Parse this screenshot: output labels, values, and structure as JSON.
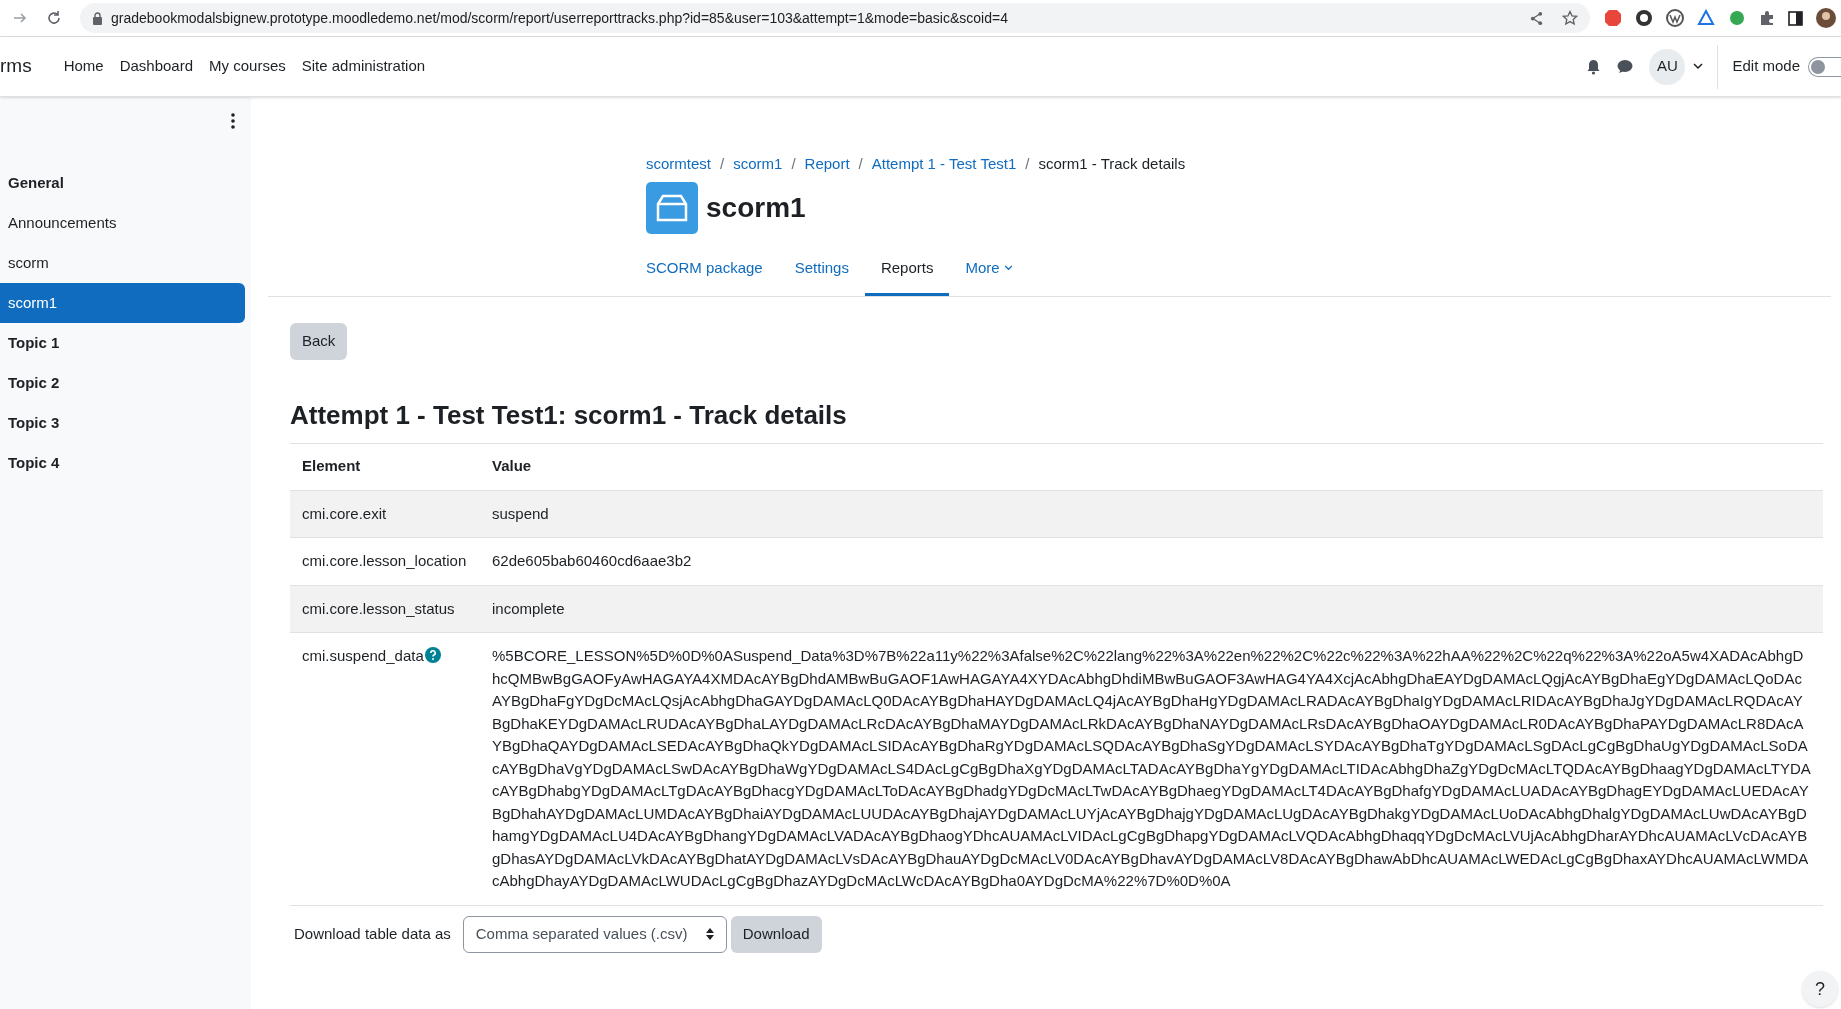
{
  "browser": {
    "url": "gradebookmodalsbignew.prototype.moodledemo.net/mod/scorm/report/userreporttracks.php?id=85&user=103&attempt=1&mode=basic&scoid=4"
  },
  "navbar": {
    "brand": "rms",
    "links": [
      "Home",
      "Dashboard",
      "My courses",
      "Site administration"
    ],
    "avatar": "AU",
    "edit_mode": {
      "label": "Edit mode",
      "on": false
    }
  },
  "sidebar": {
    "items": [
      {
        "label": "General",
        "kind": "section",
        "selected": false
      },
      {
        "label": "Announcements",
        "kind": "activity",
        "selected": false
      },
      {
        "label": "scorm",
        "kind": "activity",
        "selected": false
      },
      {
        "label": "scorm1",
        "kind": "activity",
        "selected": true
      },
      {
        "label": "Topic 1",
        "kind": "section",
        "selected": false
      },
      {
        "label": "Topic 2",
        "kind": "section",
        "selected": false
      },
      {
        "label": "Topic 3",
        "kind": "section",
        "selected": false
      },
      {
        "label": "Topic 4",
        "kind": "section",
        "selected": false
      }
    ]
  },
  "breadcrumb": [
    {
      "label": "scormtest",
      "kind": "link"
    },
    {
      "label": "/",
      "kind": "separator"
    },
    {
      "label": "scorm1",
      "kind": "link"
    },
    {
      "label": "/",
      "kind": "separator"
    },
    {
      "label": "Report",
      "kind": "link"
    },
    {
      "label": "/",
      "kind": "separator"
    },
    {
      "label": "Attempt 1 - Test Test1",
      "kind": "link"
    },
    {
      "label": "/",
      "kind": "separator"
    },
    {
      "label": "scorm1 - Track details",
      "kind": "current"
    }
  ],
  "page_title": "scorm1",
  "tabs": [
    {
      "label": "SCORM package",
      "selected": false,
      "menu": false
    },
    {
      "label": "Settings",
      "selected": false,
      "menu": false
    },
    {
      "label": "Reports",
      "selected": true,
      "menu": false
    },
    {
      "label": "More",
      "selected": false,
      "menu": true
    }
  ],
  "back_button": "Back",
  "heading": "Attempt 1 - Test Test1: scorm1 - Track details",
  "table": {
    "columns": [
      "Element",
      "Value"
    ],
    "rows": [
      {
        "element": "cmi.core.exit",
        "value": "suspend",
        "help": false
      },
      {
        "element": "cmi.core.lesson_location",
        "value": "62de605bab60460cd6aae3b2",
        "help": false
      },
      {
        "element": "cmi.core.lesson_status",
        "value": "incomplete",
        "help": false
      },
      {
        "element": "cmi.suspend_data",
        "value": "%5BCORE_LESSON%5D%0D%0ASuspend_Data%3D%7B%22a11y%22%3Afalse%2C%22lang%22%3A%22en%22%2C%22c%22%3A%22hAA%22%2C%22q%22%3A%22oA5w4XADAcAbhgDhcQMBwBgGAOFyAwHAGAYA4XMDAcAYBgDhdAMBwBuGAOF1AwHAGAYA4XYDAcAbhgDhdiMBwBuGAOF3AwHAG4YA4XcjAcAbhgDhaEAYDgDAMAcLQgjAcAYBgDhaEgYDgDAMAcLQoDAcAYBgDhaFgYDgDcMAcLQsjAcAbhgDhaGAYDgDAMAcLQ0DAcAYBgDhaHAYDgDAMAcLQ4jAcAYBgDhaHgYDgDAMAcLRADAcAYBgDhaIgYDgDAMAcLRIDAcAYBgDhaJgYDgDAMAcLRQDAcAYBgDhaKEYDgDAMAcLRUDAcAYBgDhaLAYDgDAMAcLRcDAcAYBgDhaMAYDgDAMAcLRkDAcAYBgDhaNAYDgDAMAcLRsDAcAYBgDhaOAYDgDAMAcLR0DAcAYBgDhaPAYDgDAMAcLR8DAcAYBgDhaQAYDgDAMAcLSEDAcAYBgDhaQkYDgDAMAcLSIDAcAYBgDhaRgYDgDAMAcLSQDAcAYBgDhaSgYDgDAMAcLSYDAcAYBgDhaTgYDgDAMAcLSgDAcLgCgBgDhaUgYDgDAMAcLSoDAcAYBgDhaVgYDgDAMAcLSwDAcAYBgDhaWgYDgDAMAcLS4DAcLgCgBgDhaXgYDgDAMAcLTADAcAYBgDhaYgYDgDAMAcLTIDAcAbhgDhaZgYDgDcMAcLTQDAcAYBgDhaagYDgDAMAcLTYDAcAYBgDhabgYDgDAMAcLTgDAcAYBgDhacgYDgDAMAcLToDAcAYBgDhadgYDgDcMAcLTwDAcAYBgDhaegYDgDAMAcLT4DAcAYBgDhafgYDgDAMAcLUADAcAYBgDhagEYDgDAMAcLUEDAcAYBgDhahAYDgDAMAcLUMDAcAYBgDhaiAYDgDAMAcLUUDAcAYBgDhajAYDgDAMAcLUYjAcAYBgDhajgYDgDAMAcLUgDAcAYBgDhakgYDgDAMAcLUoDAcAbhgDhalgYDgDAMAcLUwDAcAYBgDhamgYDgDAMAcLU4DAcAYBgDhangYDgDAMAcLVADAcAYBgDhaogYDhcAUAMAcLVIDAcLgCgBgDhapgYDgDAMAcLVQDAcAbhgDhaqqYDgDcMAcLVUjAcAbhgDharAYDhcAUAMAcLVcDAcAYBgDhasAYDgDAMAcLVkDAcAYBgDhatAYDgDAMAcLVsDAcAYBgDhauAYDgDcMAcLV0DAcAYBgDhavAYDgDAMAcLV8DAcAYBgDhawAbDhcAUAMAcLWEDAcLgCgBgDhaxAYDhcAUAMAcLWMDAcAbhgDhayAYDgDAMAcLWUDAcLgCgBgDhazAYDgDcMAcLWcDAcAYBgDha0AYDgDcMA%22%7D%0D%0A",
        "help": true
      }
    ]
  },
  "download": {
    "label": "Download table data as",
    "format": "Comma separated values (.csv)",
    "button": "Download"
  },
  "help_button": "?"
}
